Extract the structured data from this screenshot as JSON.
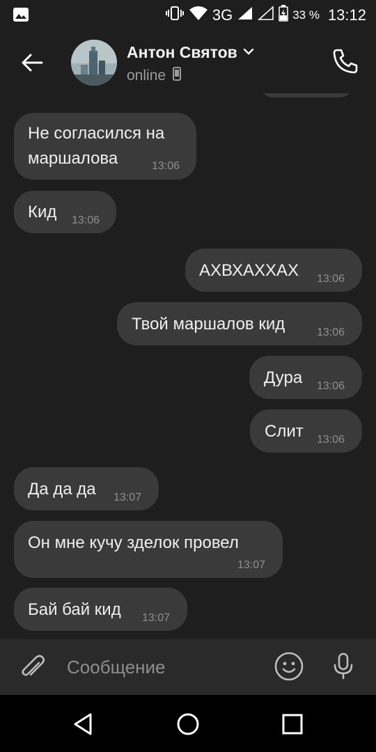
{
  "status_bar": {
    "network": "3G",
    "battery_percent": "33 %",
    "time": "13:12"
  },
  "header": {
    "contact_name": "Антон Святов",
    "status": "online"
  },
  "messages": [
    {
      "direction": "in",
      "text": "Не согласился на\nмаршалова",
      "time": "13:06"
    },
    {
      "direction": "in",
      "text": "Кид",
      "time": "13:06"
    },
    {
      "direction": "out",
      "text": "АХВХАХХАХ",
      "time": "13:06"
    },
    {
      "direction": "out",
      "text": "Твой маршалов кид",
      "time": "13:06"
    },
    {
      "direction": "out",
      "text": "Дура",
      "time": "13:06"
    },
    {
      "direction": "out",
      "text": "Слит",
      "time": "13:06"
    },
    {
      "direction": "in",
      "text": "Да да да",
      "time": "13:07"
    },
    {
      "direction": "in",
      "text": "Он мне кучу зделок провел",
      "time": "13:07"
    },
    {
      "direction": "in",
      "text": "Бай бай кид",
      "time": "13:07"
    }
  ],
  "composer": {
    "placeholder": "Сообщение"
  },
  "colors": {
    "background": "#1e1e1e",
    "bubble": "#3a3a3a",
    "composer": "#2a2a2a"
  },
  "icons": [
    "gallery-icon",
    "vibrate-icon",
    "wifi-icon",
    "signal-icon",
    "battery-icon",
    "back-arrow-icon",
    "chevron-down-icon",
    "phone-icon",
    "call-icon",
    "attach-icon",
    "emoji-icon",
    "mic-icon",
    "nav-back-icon",
    "nav-home-icon",
    "nav-recents-icon"
  ]
}
